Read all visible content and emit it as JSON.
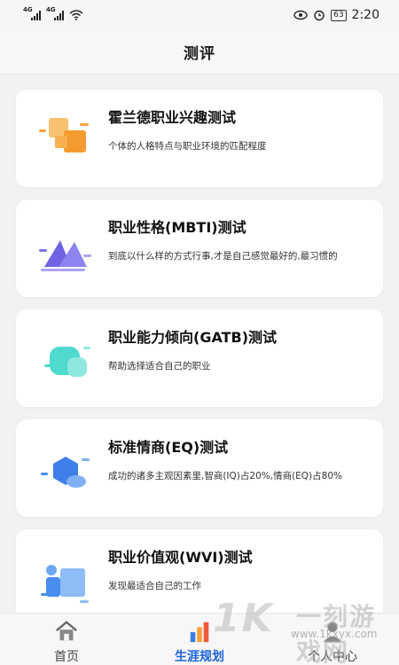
{
  "status_bar": {
    "network_1": "4G",
    "network_2": "4G",
    "battery": "63",
    "time": "2:20"
  },
  "header": {
    "title": "测评"
  },
  "cards": [
    {
      "title": "霍兰德职业兴趣测试",
      "desc": "个体的人格特点与职业环境的匹配程度",
      "icon": "holland-squares-icon"
    },
    {
      "title": "职业性格(MBTI)测试",
      "desc": "到底以什么样的方式行事,才是自己感觉最好的,最习惯的",
      "icon": "mountains-icon"
    },
    {
      "title": "职业能力倾向(GATB)测试",
      "desc": "帮助选择适合自己的职业",
      "icon": "rounded-squares-icon"
    },
    {
      "title": "标准情商(EQ)测试",
      "desc": "成功的诸多主观因素里,智商(IQ)占20%,情商(EQ)占80%",
      "icon": "hexagon-icon"
    },
    {
      "title": "职业价值观(WVI)测试",
      "desc": "发现最适合自己的工作",
      "icon": "value-blocks-icon"
    }
  ],
  "bottom_nav": [
    {
      "label": "首页",
      "icon": "home-icon"
    },
    {
      "label": "生涯规划",
      "icon": "bar-chart-icon",
      "active": true
    },
    {
      "label": "个人中心",
      "icon": "user-icon"
    }
  ],
  "watermark": {
    "text": "一刻游戏网",
    "url": "www.1kxyx.com"
  },
  "colors": {
    "accent": "#1b64d6",
    "orange": "#f7a23b",
    "purple": "#7b72e8",
    "teal": "#4fd9cf",
    "blue": "#4a8df0"
  }
}
